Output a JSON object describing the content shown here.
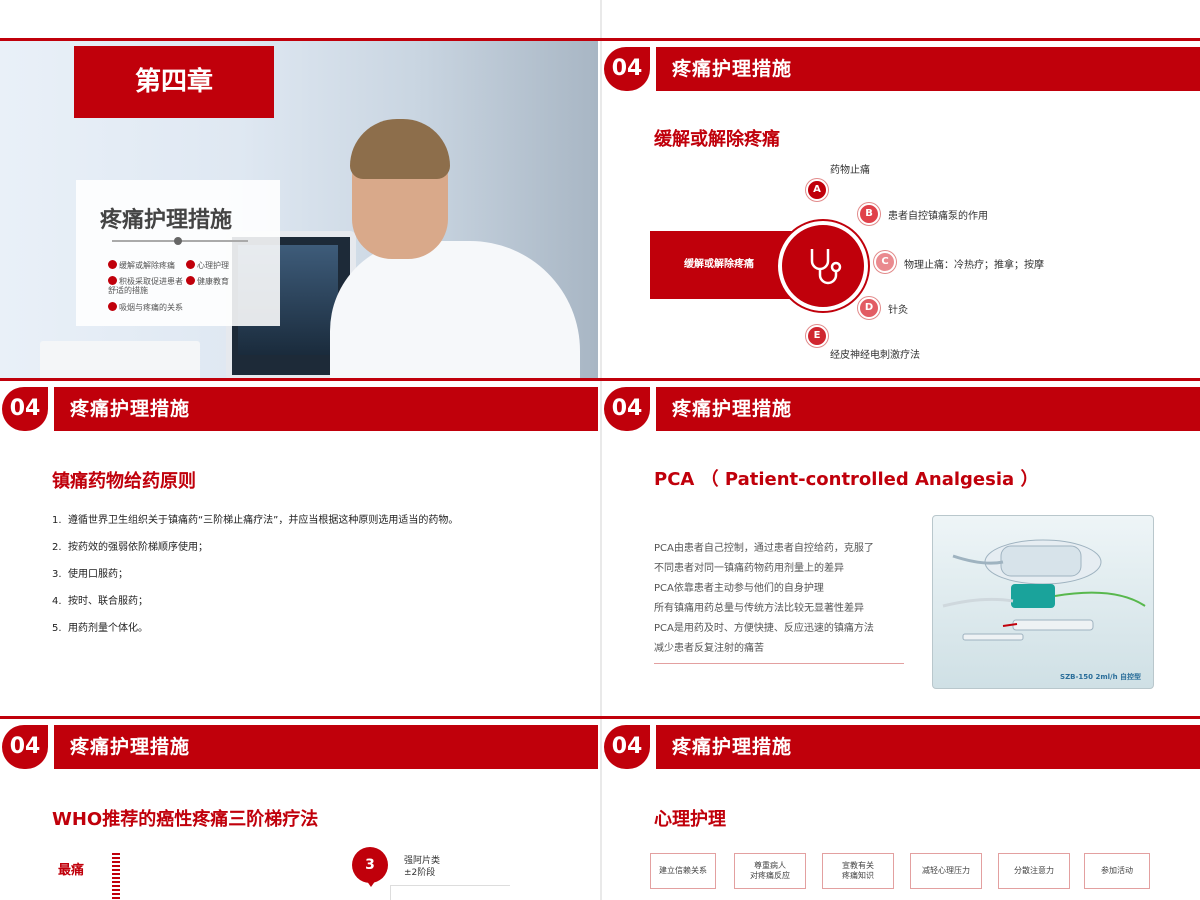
{
  "colors": {
    "accent": "#c0000b",
    "text": "#333333",
    "muted": "#555555"
  },
  "slide1": {
    "chapter": "第四章",
    "title": "疼痛护理措施",
    "toc": [
      "缓解或解除疼痛",
      "心理护理",
      "积极采取促进患者舒适的措施",
      "健康教育",
      "吸烟与疼痛的关系"
    ]
  },
  "slide2": {
    "section_num": "04",
    "header": "疼痛护理措施",
    "subtitle": "缓解或解除疼痛",
    "left_label": "缓解或解除疼痛",
    "center_icon": "stethoscope-icon",
    "items": [
      {
        "letter": "A",
        "label": "药物止痛"
      },
      {
        "letter": "B",
        "label": "患者自控镇痛泵的作用"
      },
      {
        "letter": "C",
        "label": "物理止痛：冷热疗；推拿；按摩"
      },
      {
        "letter": "D",
        "label": "针灸"
      },
      {
        "letter": "E",
        "label": "经皮神经电刺激疗法"
      }
    ]
  },
  "slide3": {
    "section_num": "04",
    "header": "疼痛护理措施",
    "subtitle": "镇痛药物给药原则",
    "rules": [
      {
        "n": "1.",
        "text": "遵循世界卫生组织关于镇痛药“三阶梯止痛疗法”，并应当根据这种原则选用适当的药物。"
      },
      {
        "n": "2.",
        "text": "按药效的强弱依阶梯顺序使用；"
      },
      {
        "n": "3.",
        "text": "使用口服药；"
      },
      {
        "n": "4.",
        "text": "按时、联合服药；"
      },
      {
        "n": "5.",
        "text": "用药剂量个体化。"
      }
    ]
  },
  "slide4": {
    "section_num": "04",
    "header": "疼痛护理措施",
    "subtitle": "PCA （ Patient-controlled Analgesia ）",
    "lines": [
      "PCA由患者自己控制，通过患者自控给药，克服了",
      "不同患者对同一镇痛药物药用剂量上的差异",
      "PCA依靠患者主动参与他们的自身护理",
      "所有镇痛用药总量与传统方法比较无显著性差异",
      "PCA是用药及时、方便快捷、反应迅速的镇痛方法",
      "减少患者反复注射的痛苦"
    ],
    "photo_caption": "SZB-150 2ml/h 自控型"
  },
  "slide5": {
    "section_num": "04",
    "header": "疼痛护理措施",
    "subtitle": "WHO推荐的癌性疼痛三阶梯疗法",
    "ladder_label": "最痛",
    "step": "3",
    "step_line1": "强阿片类",
    "step_line2": "±2阶段"
  },
  "slide6": {
    "section_num": "04",
    "header": "疼痛护理措施",
    "subtitle": "心理护理",
    "boxes": [
      {
        "line1": "建立信赖关系",
        "line2": ""
      },
      {
        "line1": "尊重病人",
        "line2": "对疼痛反应"
      },
      {
        "line1": "宣教有关",
        "line2": "疼痛知识"
      },
      {
        "line1": "减轻心理压力",
        "line2": ""
      },
      {
        "line1": "分散注意力",
        "line2": ""
      },
      {
        "line1": "参加活动",
        "line2": ""
      }
    ]
  }
}
